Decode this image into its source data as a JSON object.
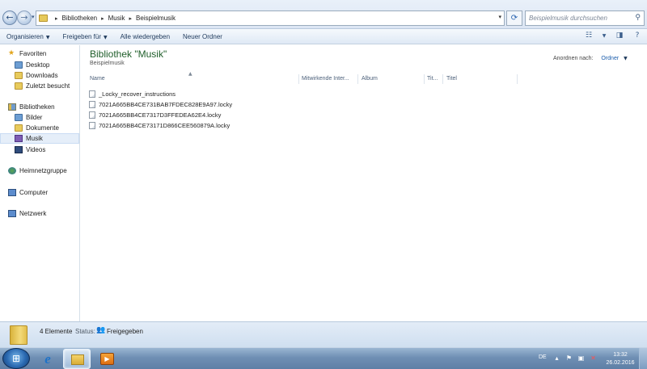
{
  "address": {
    "crumbs": [
      "Bibliotheken",
      "Musik",
      "Beispielmusik"
    ],
    "search_placeholder": "Beispielmusik durchsuchen"
  },
  "toolbar": {
    "organize": "Organisieren",
    "share": "Freigeben für",
    "play_all": "Alle wiedergeben",
    "new_folder": "Neuer Ordner"
  },
  "navpane": {
    "favorites": "Favoriten",
    "desktop": "Desktop",
    "downloads": "Downloads",
    "recent": "Zuletzt besucht",
    "libraries": "Bibliotheken",
    "pictures": "Bilder",
    "documents": "Dokumente",
    "music": "Musik",
    "videos": "Videos",
    "homegroup": "Heimnetzgruppe",
    "computer": "Computer",
    "network": "Netzwerk"
  },
  "content": {
    "title": "Bibliothek \"Musik\"",
    "subtitle": "Beispielmusik",
    "arrange_label": "Anordnen nach:",
    "arrange_value": "Ordner",
    "columns": [
      "Name",
      "Mitwirkende Inter...",
      "Album",
      "Tit...",
      "Titel"
    ],
    "files": [
      "_Locky_recover_instructions",
      "7021A665BB4CE731BAB7FDEC828E9A97.locky",
      "7021A665BB4CE7317D3FFEDEA62E4.locky",
      "7021A665BB4CE73171D866CEE560879A.locky"
    ]
  },
  "details": {
    "count": "4 Elemente",
    "status_label": "Status:",
    "status_value": "Freigegeben"
  },
  "taskbar": {
    "lang": "DE",
    "time": "13:32",
    "date": "26.02.2016"
  }
}
